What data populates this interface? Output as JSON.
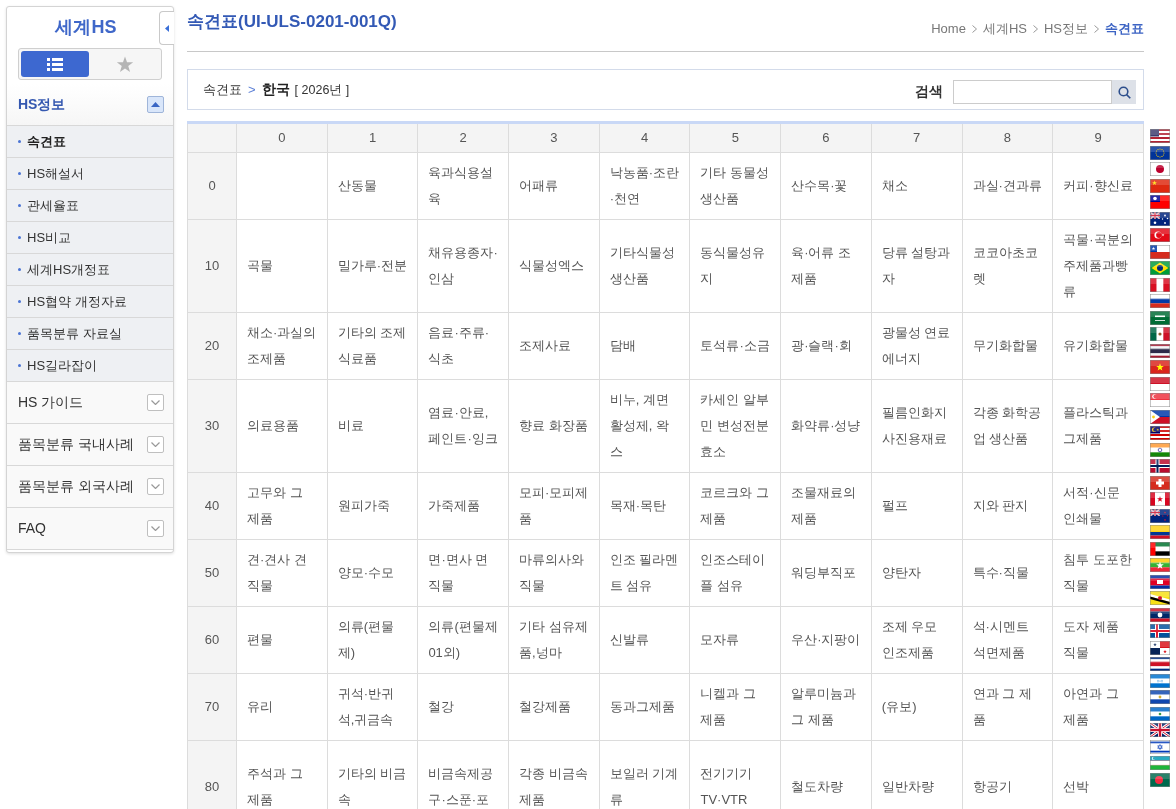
{
  "sidebar": {
    "title": "세계HS",
    "view_tabs": [
      {
        "kind": "list",
        "selected": true
      },
      {
        "kind": "star",
        "selected": false
      }
    ],
    "menu": [
      {
        "label": "HS정보",
        "expanded": true,
        "children": [
          {
            "label": "속견표",
            "selected": true
          },
          {
            "label": "HS해설서",
            "selected": false
          },
          {
            "label": "관세율표",
            "selected": false
          },
          {
            "label": "HS비교",
            "selected": false
          },
          {
            "label": "세계HS개정표",
            "selected": false
          },
          {
            "label": "HS협약 개정자료",
            "selected": false
          },
          {
            "label": "품목분류 자료실",
            "selected": false
          },
          {
            "label": "HS길라잡이",
            "selected": false
          }
        ]
      },
      {
        "label": "HS 가이드",
        "expanded": false
      },
      {
        "label": "품목분류 국내사례",
        "expanded": false
      },
      {
        "label": "품목분류 외국사례",
        "expanded": false
      },
      {
        "label": "FAQ",
        "expanded": false
      }
    ]
  },
  "page_title": "속견표(UI-ULS-0201-001Q)",
  "breadcrumb": [
    {
      "label": "Home",
      "selected": false
    },
    {
      "label": "세계HS",
      "selected": false
    },
    {
      "label": "HS정보",
      "selected": false
    },
    {
      "label": "속견표",
      "selected": true
    }
  ],
  "filter_bar": {
    "section": "속견표",
    "separator": ">",
    "country": "한국",
    "year": "[ 2026년 ]",
    "search": {
      "label": "검색"
    }
  },
  "table": {
    "columns": [
      "0",
      "1",
      "2",
      "3",
      "4",
      "5",
      "6",
      "7",
      "8",
      "9"
    ],
    "rows": [
      {
        "heading": "0",
        "cells": [
          null,
          "산동물",
          "육과식용설육",
          "어패류",
          "낙농품·조란·천연",
          "기타 동물성 생산품",
          "산수목·꽃",
          "채소",
          "과실·견과류",
          "커피·향신료"
        ]
      },
      {
        "heading": "10",
        "cells": [
          "곡물",
          "밀가루·전분",
          "채유용종자·인삼",
          "식물성엑스",
          "기타식물성 생산품",
          "동식물성유지",
          "육·어류 조제품",
          "당류 설탕과자",
          "코코아초코렛",
          "곡물·곡분의 주제품과빵류"
        ]
      },
      {
        "heading": "20",
        "cells": [
          "채소·과실의 조제품",
          "기타의 조제 식료품",
          "음료·주류·식초",
          "조제사료",
          "담배",
          "토석류·소금",
          "광·슬랙·회",
          "광물성 연료 에너지",
          "무기화합물",
          "유기화합물"
        ]
      },
      {
        "heading": "30",
        "cells": [
          "의료용품",
          "비료",
          "염료·안료, 페인트·잉크",
          "향료 화장품",
          "비누, 계면활성제, 왁스",
          "카세인 알부민 변성전분 효소",
          "화약류·성냥",
          "필름인화지 사진용재료",
          "각종 화학공업 생산품",
          "플라스틱과 그제품"
        ]
      },
      {
        "heading": "40",
        "cells": [
          "고무와 그 제품",
          "원피가죽",
          "가죽제품",
          "모피·모피제품",
          "목재·목탄",
          "코르크와 그 제품",
          "조물재료의 제품",
          "펄프",
          "지와 판지",
          "서적·신문 인쇄물"
        ]
      },
      {
        "heading": "50",
        "cells": [
          "견·견사 견직물",
          "양모·수모",
          "면·면사 면직물",
          "마류의사와 직물",
          "인조 필라멘트 섬유",
          "인조스테이플 섬유",
          "워딩부직포",
          "양탄자",
          "특수·직물",
          "침투 도포한 직물"
        ]
      },
      {
        "heading": "60",
        "cells": [
          "편물",
          "의류(편물제)",
          "의류(편물제01외)",
          "기타 섬유제품,넝마",
          "신발류",
          "모자류",
          "우산·지팡이",
          "조제 우모 인조제품",
          "석·시멘트 석면제품",
          "도자 제품 직물"
        ]
      },
      {
        "heading": "70",
        "cells": [
          "유리",
          "귀석·반귀석,귀금속",
          "철강",
          "철강제품",
          "동과그제품",
          "니켈과 그 제품",
          "알루미늄과 그 제품",
          "(유보)",
          "연과 그 제품",
          "아연과 그 제품"
        ]
      },
      {
        "heading": "80",
        "cells": [
          "주석과 그 제품",
          "기타의 비금속",
          "비금속제공구·스푼·포",
          "각종 비금속 제품",
          "보일러 기계류",
          "전기기기 TV·VTR",
          "철도차량",
          "일반차량",
          "항공기",
          "선박"
        ]
      }
    ]
  }
}
